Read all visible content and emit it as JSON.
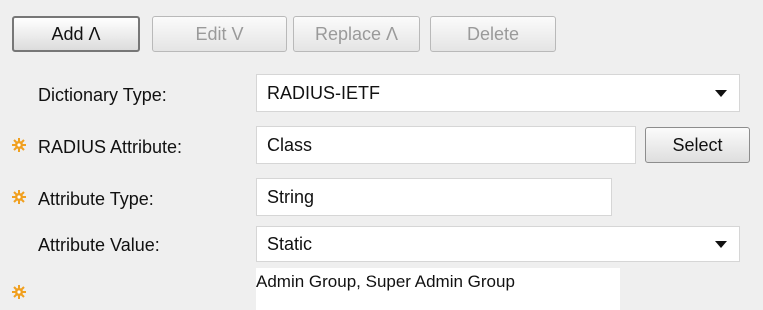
{
  "toolbar": {
    "add_label": "Add Λ",
    "edit_label": "Edit V",
    "replace_label": "Replace Λ",
    "delete_label": "Delete"
  },
  "form": {
    "dictionary_type": {
      "label": "Dictionary Type:",
      "value": "RADIUS-IETF",
      "required": false
    },
    "radius_attribute": {
      "label": "RADIUS Attribute:",
      "value": "Class",
      "required": true,
      "select_label": "Select"
    },
    "attribute_type": {
      "label": "Attribute Type:",
      "value": "String",
      "required": true
    },
    "attribute_value": {
      "label": "Attribute Value:",
      "value": "Static",
      "required": false
    },
    "static_value": {
      "value": "Admin Group, Super Admin Group",
      "required": true
    }
  },
  "colors": {
    "required_star": "#f0a020"
  },
  "icons": {
    "required": "gear-star-icon",
    "dropdown": "chevron-down-icon"
  }
}
